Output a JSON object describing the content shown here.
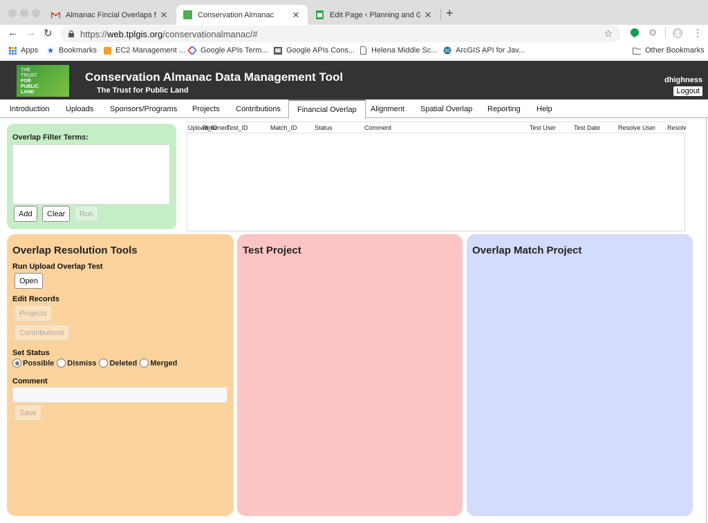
{
  "browser": {
    "tabs": [
      {
        "title": "Almanac Fincial Overlaps funct",
        "active": false
      },
      {
        "title": "Conservation Almanac",
        "active": true
      },
      {
        "title": "Edit Page ‹ Planning and GIS —",
        "active": false
      }
    ],
    "url": {
      "scheme": "https://",
      "host": "web.tplgis.org",
      "path": "/conservationalmanac/#"
    },
    "bookmarks": [
      {
        "label": "Apps",
        "icon": "apps-grid-icon"
      },
      {
        "label": "Bookmarks",
        "icon": "star-icon"
      },
      {
        "label": "EC2 Management ...",
        "icon": "aws-box-icon"
      },
      {
        "label": "Google APIs Term...",
        "icon": "google-apis-icon"
      },
      {
        "label": "Google APIs Cons...",
        "icon": "console-icon"
      },
      {
        "label": "Helena Middle Sc...",
        "icon": "page-icon"
      },
      {
        "label": "ArcGIS API for Jav...",
        "icon": "globe-icon"
      }
    ],
    "other_bookmarks": "Other Bookmarks"
  },
  "app": {
    "logo_lines": [
      "THE",
      "TRUST",
      "FOR",
      "PUBLIC",
      "LAND"
    ],
    "title": "Conservation Almanac Data Management Tool",
    "subtitle": "The Trust for Public Land",
    "username": "dhighness",
    "logout": "Logout",
    "nav": [
      "Introduction",
      "Uploads",
      "Sponsors/Programs",
      "Projects",
      "Contributions",
      "Financial Overlap",
      "Alignment",
      "Spatial Overlap",
      "Reporting",
      "Help"
    ],
    "active_nav": "Financial Overlap"
  },
  "filter": {
    "label": "Overlap Filter Terms:",
    "add": "Add",
    "clear": "Clear",
    "run": "Run"
  },
  "grid": {
    "overlapping_header": "Upload_ID",
    "overlapping_header2": "Returned",
    "columns": [
      "Test_ID",
      "Match_ID",
      "Status",
      "Comment",
      "Test User",
      "Test Date",
      "Resolve User",
      "Resolv"
    ]
  },
  "resolution": {
    "title": "Overlap Resolution Tools",
    "run_label": "Run Upload Overlap Test",
    "open": "Open",
    "edit_label": "Edit Records",
    "projects": "Projects",
    "contributions": "Contributions",
    "status_label": "Set Status",
    "statuses": [
      "Possible",
      "Dismiss",
      "Deleted",
      "Merged"
    ],
    "selected_status": "Possible",
    "comment_label": "Comment",
    "save": "Save"
  },
  "test_project": {
    "title": "Test Project"
  },
  "match_project": {
    "title": "Overlap Match Project"
  },
  "colors": {
    "filter_panel": "#c6eec6",
    "resolution_panel": "#fcd39c",
    "test_panel": "#fcc5c4",
    "match_panel": "#d4dcfc",
    "header_bg": "#333333"
  }
}
